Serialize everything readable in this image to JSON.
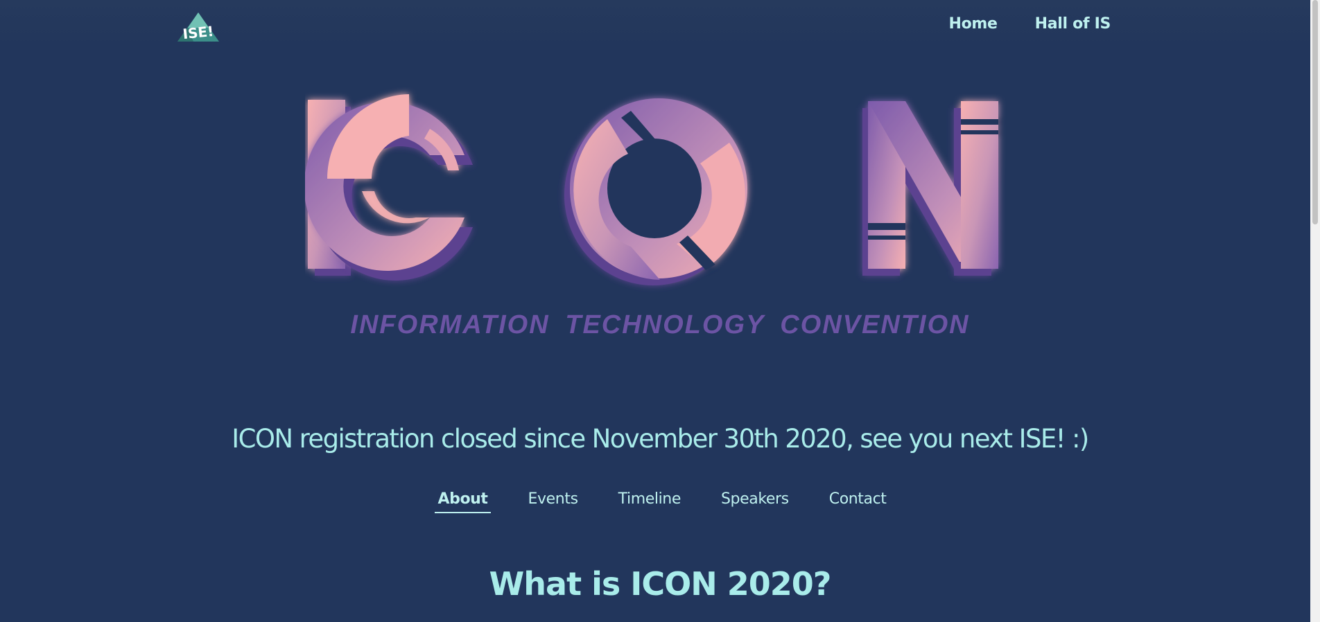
{
  "header": {
    "logo_text": "ISE!",
    "nav": [
      {
        "label": "Home"
      },
      {
        "label": "Hall of IS"
      }
    ]
  },
  "hero": {
    "logo_text": "ICON",
    "tagline": "INFORMATION  TECHNOLOGY  CONVENTION"
  },
  "announcement": "ICON registration closed since November 30th 2020, see you next ISE! :)",
  "tabs": [
    {
      "label": "About",
      "active": true
    },
    {
      "label": "Events",
      "active": false
    },
    {
      "label": "Timeline",
      "active": false
    },
    {
      "label": "Speakers",
      "active": false
    },
    {
      "label": "Contact",
      "active": false
    }
  ],
  "section": {
    "title": "What is ICON 2020?"
  },
  "colors": {
    "background": "#22365c",
    "accent_text": "#a9ecea",
    "pink": "#f5afb1",
    "purple": "#8a64b0",
    "tagline": "#6c54a4"
  }
}
